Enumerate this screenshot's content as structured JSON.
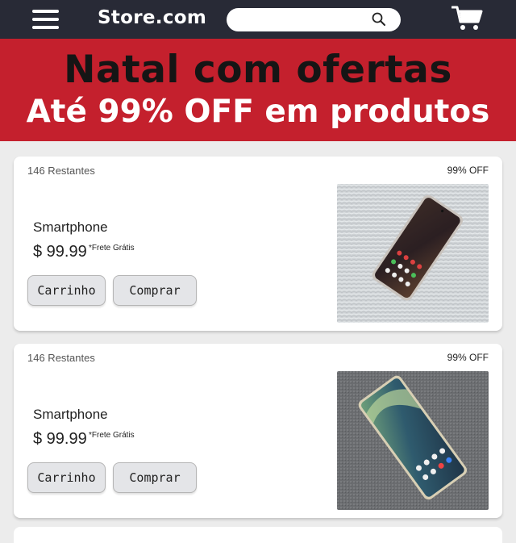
{
  "header": {
    "brand": "Store.com",
    "search_value": "",
    "search_placeholder": ""
  },
  "banner": {
    "title": "Natal com ofertas",
    "subtitle": "Até 99% OFF em produtos"
  },
  "colors": {
    "topbar": "#282a36",
    "banner": "#c4202d",
    "background": "#ececec"
  },
  "products": [
    {
      "stock_label": "146 Restantes",
      "discount": "99% OFF",
      "name": "Smartphone",
      "price": "$ 99.99",
      "shipping": "*Frete Grátis",
      "cart_label": "Carrinho",
      "buy_label": "Comprar",
      "image_icon": "smartphone-photo-upright"
    },
    {
      "stock_label": "146 Restantes",
      "discount": "99% OFF",
      "name": "Smartphone",
      "price": "$ 99.99",
      "shipping": "*Frete Grátis",
      "cart_label": "Carrinho",
      "buy_label": "Comprar",
      "image_icon": "smartphone-photo-tilted"
    }
  ]
}
